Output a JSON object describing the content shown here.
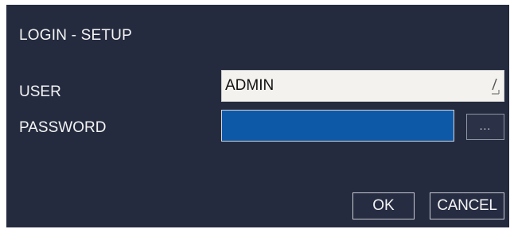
{
  "dialog": {
    "title": "LOGIN - SETUP"
  },
  "form": {
    "user_label": "USER",
    "user_value": "ADMIN",
    "password_label": "PASSWORD",
    "password_value": "",
    "more_button_label": "...",
    "edit_icon": "pencil-edit-icon"
  },
  "buttons": {
    "ok_label": "OK",
    "cancel_label": "CANCEL"
  },
  "colors": {
    "background": "#252b3f",
    "user_field": "#f3f2ee",
    "password_field": "#0e58a8"
  }
}
